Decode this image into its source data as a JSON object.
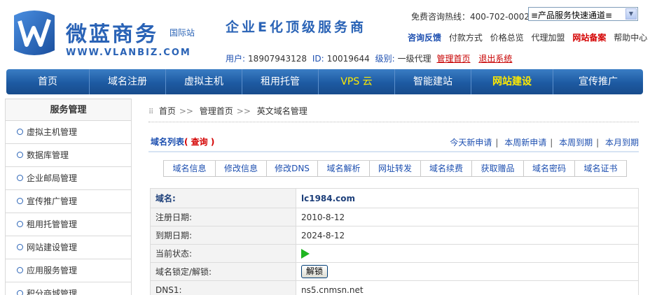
{
  "brand": {
    "name_cn": "微蓝商务",
    "intl": "国际站",
    "url": "WWW.VLANBIZ.COM",
    "slogan": "企业E化顶级服务商",
    "colors": {
      "primary": "#2a63b6",
      "accent_red": "#d40000",
      "nav_bg": "#1d5aa2"
    }
  },
  "header": {
    "hotline": "免费咨询热线：400-702-0002",
    "quick_channel": "≡产品服务快速通道≡",
    "toplinks": [
      "咨询反馈",
      "付款方式",
      "价格总览",
      "代理加盟",
      "网站备案",
      "帮助中心"
    ]
  },
  "user": {
    "user_label": "用户:",
    "user_value": "18907943128",
    "id_label": "ID:",
    "id_value": "10019644",
    "level_label": "级别:",
    "level_value": "一级代理",
    "admin_home": "管理首页",
    "logout": "退出系统"
  },
  "nav": [
    "首页",
    "域名注册",
    "虚拟主机",
    "租用托管",
    "VPS 云",
    "智能建站",
    "网站建设",
    "宣传推广"
  ],
  "sidebar": {
    "title": "服务管理",
    "items": [
      "虚拟主机管理",
      "数据库管理",
      "企业邮局管理",
      "宣传推广管理",
      "租用托管管理",
      "网站建设管理",
      "应用服务管理",
      "积分商城管理"
    ]
  },
  "breadcrumb": [
    "首页",
    "管理首页",
    "英文域名管理"
  ],
  "list": {
    "title": "域名列表",
    "query": "( 查询 )",
    "filters": [
      "今天新申请",
      "本周新申请",
      "本周到期",
      "本月到期"
    ]
  },
  "tabs": [
    "域名信息",
    "修改信息",
    "修改DNS",
    "域名解析",
    "网址转发",
    "域名续费",
    "获取赠品",
    "域名密码",
    "域名证书"
  ],
  "domain_info": {
    "head_label": "域名:",
    "head_value": "lc1984.com",
    "rows": [
      {
        "label": "注册日期:",
        "value": "2010-8-12"
      },
      {
        "label": "到期日期:",
        "value": "2024-8-12"
      },
      {
        "label": "当前状态:",
        "value": ""
      },
      {
        "label": "域名锁定/解锁:",
        "value": ""
      },
      {
        "label": "DNS1:",
        "value": "ns5.cnmsn.net"
      }
    ],
    "unlock_button": "解锁",
    "status_icon": "play-icon"
  }
}
